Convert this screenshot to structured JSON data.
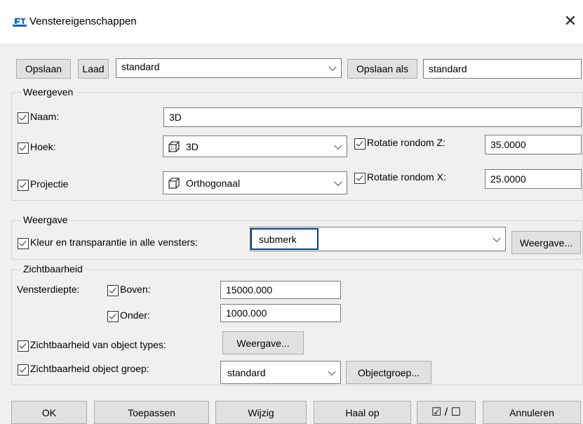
{
  "window": {
    "title": "Venstereigenschappen",
    "app_icon": "app-logo-icon",
    "close_icon": "close-icon"
  },
  "toolbar": {
    "save_label": "Opslaan",
    "load_label": "Laad",
    "preset_value": "standard",
    "save_as_label": "Opslaan als",
    "save_as_value": "standard"
  },
  "weergeven": {
    "title": "Weergeven",
    "naam_label": "Naam:",
    "naam_value": "3D",
    "hoek_label": "Hoek:",
    "hoek_value": "3D",
    "rot_z_label": "Rotatie rondom Z:",
    "rot_z_value": "35.0000",
    "projectie_label": "Projectie",
    "projectie_value": "Orthogonaal",
    "rot_x_label": "Rotatie rondom X:",
    "rot_x_value": "25.0000"
  },
  "weergave": {
    "title": "Weergave",
    "kleur_label": "Kleur en transparantie in alle vensters:",
    "kleur_value": "submerk",
    "button_label": "Weergave..."
  },
  "zichtbaarheid": {
    "title": "Zichtbaarheid",
    "diepte_label": "Vensterdiepte:",
    "boven_label": "Boven:",
    "boven_value": "15000.000",
    "onder_label": "Onder:",
    "onder_value": "1000.000",
    "types_label": "Zichtbaarheid van object types:",
    "types_button": "Weergave...",
    "groep_label": "Zichtbaarheid object groep:",
    "groep_value": "standard",
    "groep_button": "Objectgroep..."
  },
  "footer": {
    "ok": "OK",
    "apply": "Toepassen",
    "modify": "Wijzig",
    "fetch": "Haal op",
    "toggle_all": "☑ / ☐",
    "cancel": "Annuleren"
  }
}
